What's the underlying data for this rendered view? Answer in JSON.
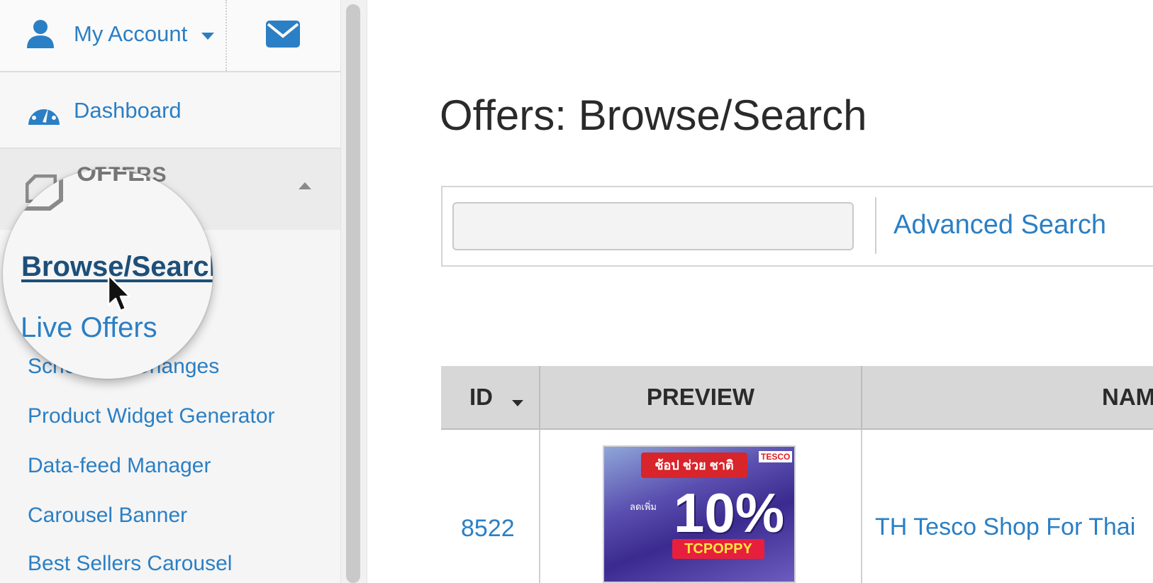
{
  "account": {
    "label": "My Account"
  },
  "sidebar": {
    "dashboard_label": "Dashboard",
    "offers_label": "OFFERS",
    "items": [
      {
        "label": "Browse/Search",
        "active": true
      },
      {
        "label": "Live Offers"
      },
      {
        "label": "Scheduled Changes"
      },
      {
        "label": "Product Widget Generator"
      },
      {
        "label": "Data-feed Manager"
      },
      {
        "label": "Carousel Banner"
      },
      {
        "label": "Best Sellers Carousel"
      }
    ]
  },
  "main": {
    "title": "Offers: Browse/Search",
    "search": {
      "value": "",
      "placeholder": "",
      "advanced_label": "Advanced Search"
    },
    "table": {
      "headers": {
        "id": "ID",
        "preview": "PREVIEW",
        "name": "NAME"
      },
      "rows": [
        {
          "id": "8522",
          "name": "TH Tesco Shop For Thai",
          "preview": {
            "top": "ช้อป ช่วย ชาติ",
            "discount": "10%",
            "code": "TCPOPPY",
            "brand": "TESCO",
            "tag": "ลดเพิ่ม"
          }
        }
      ]
    }
  },
  "colors": {
    "link": "#2b7fc4",
    "active": "#1d4f78",
    "header_bg": "#d7d7d7"
  }
}
